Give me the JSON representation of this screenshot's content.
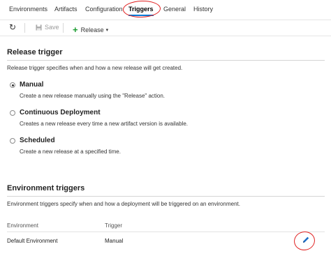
{
  "tabs": [
    {
      "label": "Environments"
    },
    {
      "label": "Artifacts"
    },
    {
      "label": "Configuration"
    },
    {
      "label": "Triggers",
      "active": true
    },
    {
      "label": "General"
    },
    {
      "label": "History"
    }
  ],
  "toolbar": {
    "refresh_icon": "refresh-icon",
    "save_label": "Save",
    "release_label": "Release",
    "release_caret": "▾"
  },
  "release_trigger": {
    "title": "Release trigger",
    "description": "Release trigger specifies when and how a new release will get created.",
    "options": [
      {
        "label": "Manual",
        "description": "Create a new release manually using the \"Release\" action.",
        "selected": true
      },
      {
        "label": "Continuous Deployment",
        "description": "Creates a new release every time a new artifact version is available.",
        "selected": false
      },
      {
        "label": "Scheduled",
        "description": "Create a new release at a specified time.",
        "selected": false
      }
    ]
  },
  "environment_triggers": {
    "title": "Environment triggers",
    "description": "Environment triggers specify when and how a deployment will be triggered on an environment.",
    "columns": [
      "Environment",
      "Trigger"
    ],
    "rows": [
      {
        "environment": "Default Environment",
        "trigger": "Manual"
      }
    ]
  },
  "colors": {
    "accent": "#0078d7",
    "annotation": "#e02020",
    "plus": "#1a9c2f"
  }
}
